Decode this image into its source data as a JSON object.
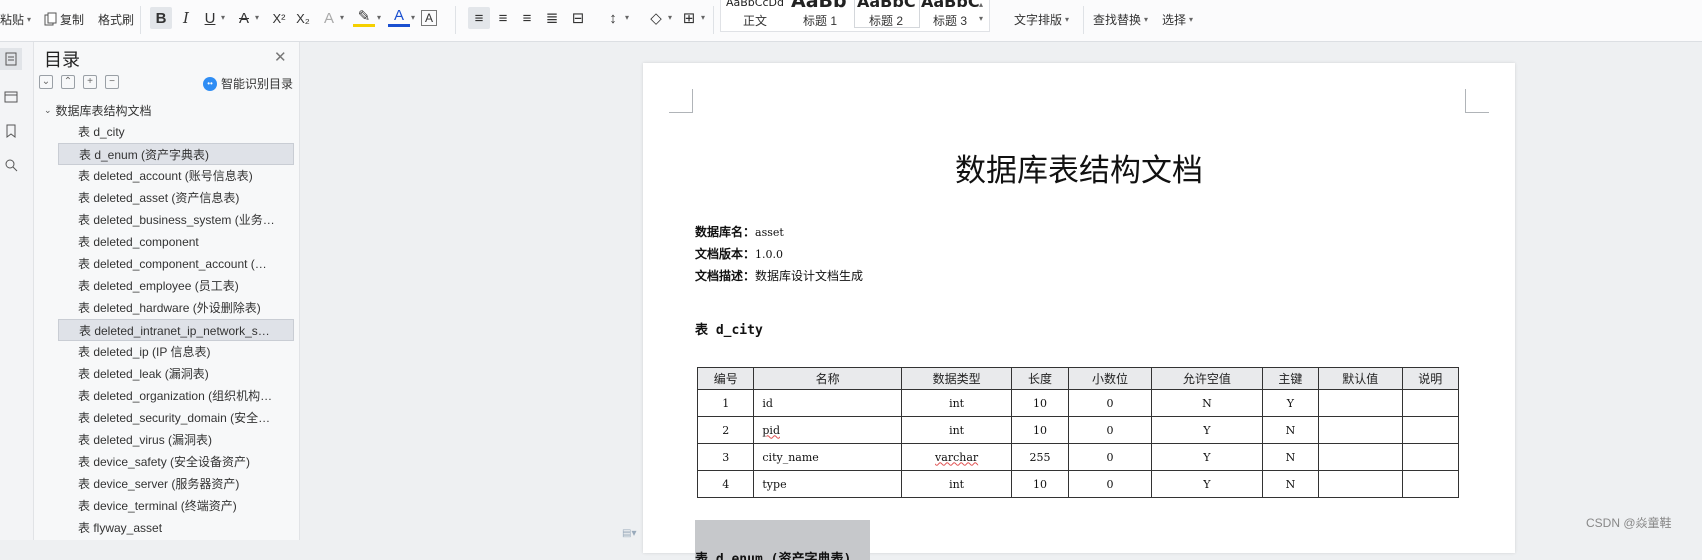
{
  "toolbar": {
    "paste_label": "粘贴",
    "copy_label": "复制",
    "format_painter_label": "格式刷",
    "styles": [
      {
        "preview": "AaBbCcDd",
        "label": "正文"
      },
      {
        "preview": "AaBb",
        "label": "标题 1"
      },
      {
        "preview": "AaBbC",
        "label": "标题 2"
      },
      {
        "preview": "AaBbCc",
        "label": "标题 3"
      }
    ],
    "text_layout_label": "文字排版",
    "find_replace_label": "查找替换",
    "select_label": "选择"
  },
  "toc": {
    "title": "目录",
    "smart_label": "智能识别目录",
    "root": "数据库表结构文档",
    "items": [
      "表 d_city",
      "表 d_enum (资产字典表)",
      "表 deleted_account (账号信息表)",
      "表 deleted_asset (资产信息表)",
      "表 deleted_business_system (业务…",
      "表 deleted_component",
      "表 deleted_component_account (…",
      "表 deleted_employee (员工表)",
      "表 deleted_hardware (外设删除表)",
      "表 deleted_intranet_ip_network_s…",
      "表 deleted_ip (IP 信息表)",
      "表 deleted_leak (漏洞表)",
      "表 deleted_organization (组织机构…",
      "表 deleted_security_domain (安全…",
      "表 deleted_virus (漏洞表)",
      "表 device_safety (安全设备资产)",
      "表 device_server (服务器资产)",
      "表 device_terminal (终端资产)",
      "表 flyway_asset"
    ]
  },
  "document": {
    "title": "数据库表结构文档",
    "meta": [
      {
        "label": "数据库名：",
        "value": "asset"
      },
      {
        "label": "文档版本：",
        "value": "1.0.0"
      },
      {
        "label": "文档描述：",
        "value": "数据库设计文档生成"
      }
    ],
    "table_heading": "表 d_city",
    "columns": [
      "编号",
      "名称",
      "数据类型",
      "长度",
      "小数位",
      "允许空值",
      "主键",
      "默认值",
      "说明"
    ],
    "rows": [
      [
        "1",
        "id",
        "int",
        "10",
        "0",
        "N",
        "Y",
        "",
        ""
      ],
      [
        "2",
        "pid",
        "int",
        "10",
        "0",
        "Y",
        "N",
        "",
        ""
      ],
      [
        "3",
        "city_name",
        "varchar",
        "255",
        "0",
        "Y",
        "N",
        "",
        ""
      ],
      [
        "4",
        "type",
        "int",
        "10",
        "0",
        "Y",
        "N",
        "",
        ""
      ]
    ],
    "next_heading": "表 d_enum (资产字典表)"
  },
  "watermark": "CSDN @焱童鞋"
}
